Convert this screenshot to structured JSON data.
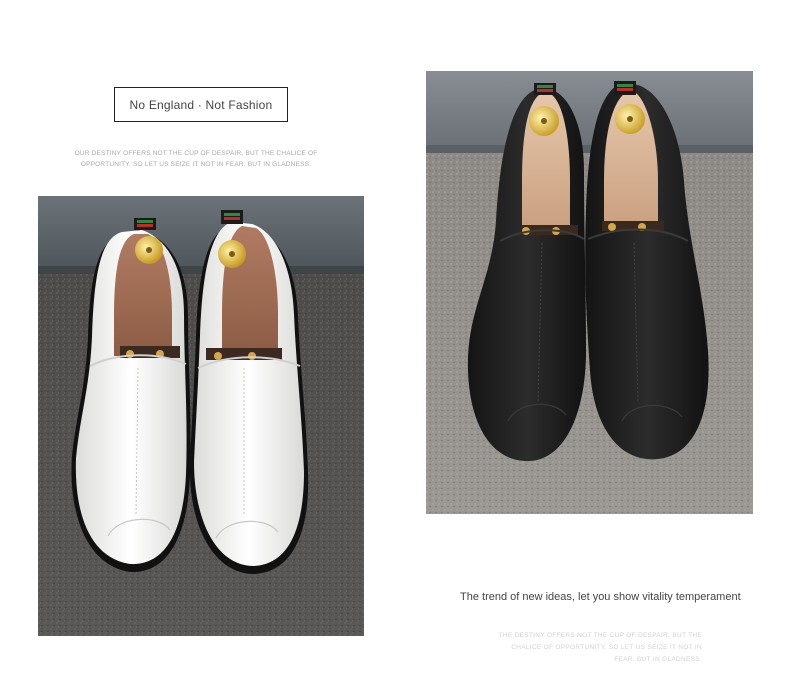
{
  "badge": {
    "label": "No England · Not Fashion"
  },
  "quote_small": {
    "line1": "OUR DESTINY OFFERS NOT THE CUP OF DESPAIR, BUT THE CHALICE OF",
    "line2": "OPPORTUNITY. SO LET US SEIZE IT NOT IN FEAR, BUT IN GLADNESS."
  },
  "photos": {
    "left": {
      "subject": "white-leather-loafers",
      "accent_color": "#f4f4f2"
    },
    "right": {
      "subject": "black-leather-loafers",
      "accent_color": "#1c1c1c"
    }
  },
  "tagline": {
    "text": "The trend of new ideas, let you show vitality temperament"
  },
  "quote_faded": {
    "line1": "THE DESTINY OFFERS NOT THE CUP OF DESPAIR, BUT THE",
    "line2": "CHALICE OF OPPORTUNITY. SO LET US SEIZE IT NOT IN",
    "line3": "FEAR, BUT IN GLADNESS."
  }
}
